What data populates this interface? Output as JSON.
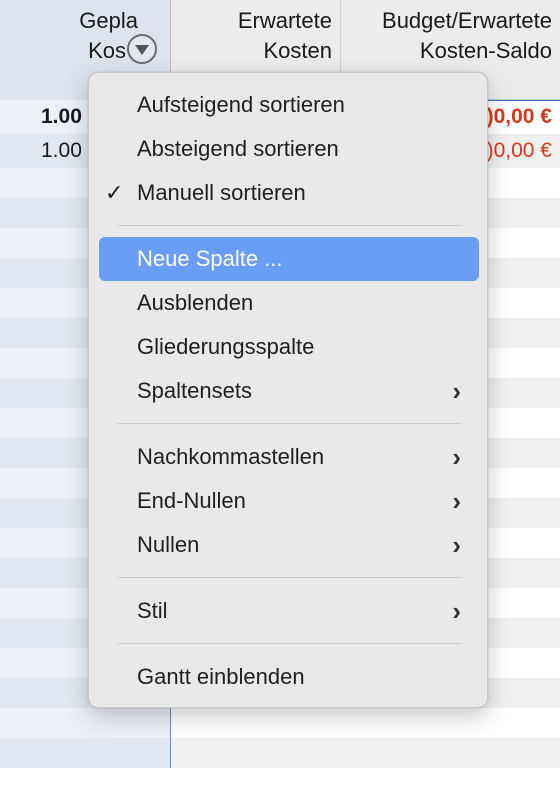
{
  "table": {
    "headers": [
      {
        "line1": "Gepla",
        "line2": "Kos"
      },
      {
        "line1": "Erwartete",
        "line2": "Kosten"
      },
      {
        "line1": "Budget/Erwartete",
        "line2": "Kosten-Saldo"
      }
    ],
    "rows": [
      {
        "c1": "1.00",
        "c3": ")0,00 €",
        "bold": true
      },
      {
        "c1": "1.00",
        "c3": ")0,00 €",
        "bold": false
      }
    ]
  },
  "menu": {
    "items": [
      {
        "label": "Aufsteigend sortieren"
      },
      {
        "label": "Absteigend sortieren"
      },
      {
        "label": "Manuell sortieren",
        "checked": true
      },
      {
        "label": "Neue Spalte ...",
        "highlighted": true
      },
      {
        "label": "Ausblenden"
      },
      {
        "label": "Gliederungsspalte"
      },
      {
        "label": "Spaltensets",
        "submenu": true
      },
      {
        "label": "Nachkommastellen",
        "submenu": true
      },
      {
        "label": "End-Nullen",
        "submenu": true
      },
      {
        "label": "Nullen",
        "submenu": true
      },
      {
        "label": "Stil",
        "submenu": true
      },
      {
        "label": "Gantt einblenden"
      }
    ],
    "check_glyph": "✓",
    "chevron_glyph": "›"
  },
  "colors": {
    "highlight": "#6a9ef4",
    "negative_value": "#d8391a",
    "column_selection_border": "#3a6bd1"
  }
}
